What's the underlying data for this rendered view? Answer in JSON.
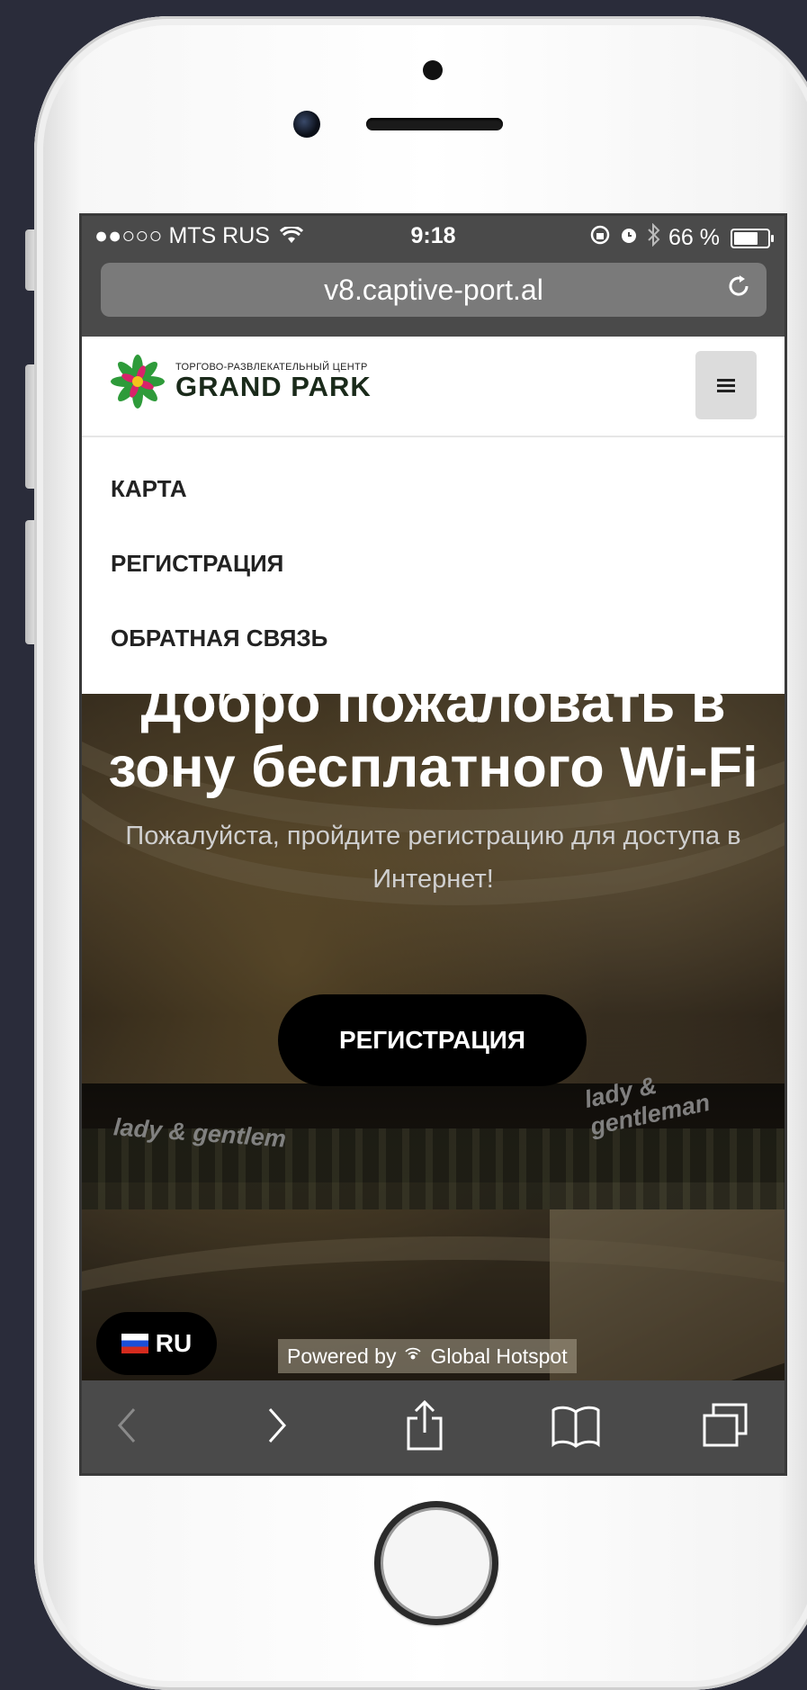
{
  "status_bar": {
    "carrier": "●●○○○ MTS RUS",
    "time": "9:18",
    "battery": "66 %"
  },
  "browser": {
    "url": "v8.captive-port.al"
  },
  "site": {
    "logo_small": "ТОРГОВО-РАЗВЛЕКАТЕЛЬНЫЙ ЦЕНТР",
    "logo_name": "GRAND PARK",
    "menu": [
      "КАРТА",
      "РЕГИСТРАЦИЯ",
      "ОБРАТНАЯ СВЯЗЬ"
    ],
    "hero_title_line1": "Добро пожаловать в",
    "hero_title_line2": "зону бесплатного Wi-Fi",
    "hero_subtitle_line1": "Пожалуйста, пройдите регистрацию для доступа в",
    "hero_subtitle_line2": "Интернет!",
    "register_button": "РЕГИСТРАЦИЯ",
    "language": "RU",
    "powered_by": "Powered by",
    "powered_brand": "Global Hotspot",
    "bg_signs": [
      "lady & gentleman",
      "lady & gentlem"
    ]
  },
  "colors": {
    "button_bg": "#000000",
    "chrome_bg": "#4a4a4a"
  }
}
